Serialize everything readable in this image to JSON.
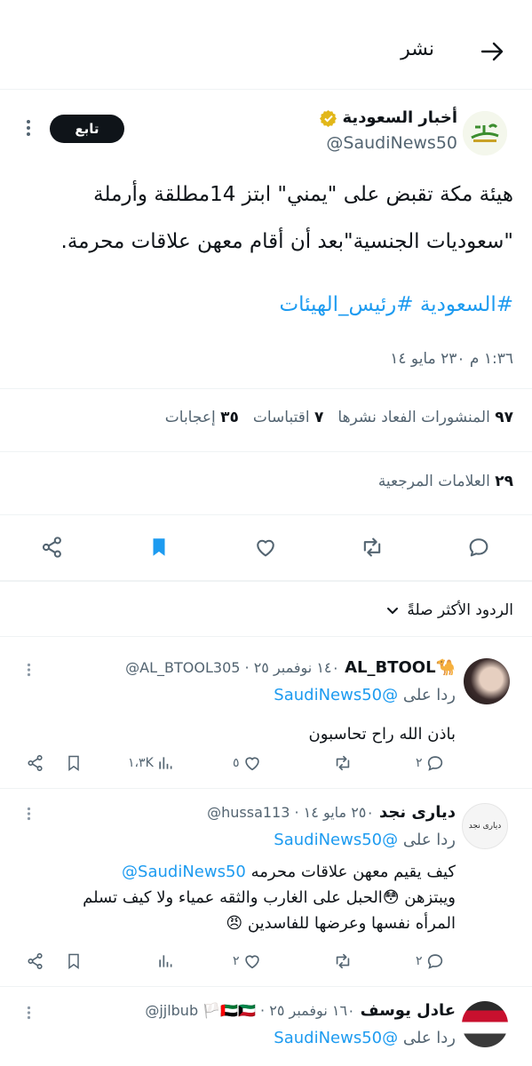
{
  "header": {
    "title": "نشر"
  },
  "post": {
    "name": "أخبار السعودية",
    "handle": "@SaudiNews50",
    "avatar_text": "أخبار",
    "follow_label": "تابع",
    "text_line1": "هيئة مكة تقبض على \"يمني\"  ابتز 14مطلقة وأرملة",
    "text_line2": "\"سعوديات الجنسية\"بعد أن أقام معهن علاقات محرمة.",
    "hashtags": "#السعودية #رئيس_الهيئات",
    "time": "١:٣٦ م ٢٣٠ مايو ١٤",
    "stats": [
      {
        "count": "٩٧",
        "label": "المنشورات الفعاد نشرها"
      },
      {
        "count": "٧",
        "label": "اقتباسات"
      },
      {
        "count": "٣٥",
        "label": "إعجابات"
      }
    ],
    "bookmarks": {
      "count": "٢٩",
      "label": "العلامات المرجعية"
    }
  },
  "sort": {
    "label": "الردود الأكثر صلةً"
  },
  "replies": [
    {
      "name": "AL_BTOOL🐪",
      "handle_meta": "@AL_BTOOL305 · ١٤٠ نوفمبر ٢٥",
      "reply_prefix": "ردا على",
      "reply_to": "@SaudiNews50",
      "body": "باذن الله راح تحاسبون",
      "views": "١،٣K",
      "likes": "٥",
      "replies_count": "٢",
      "retweets": ""
    },
    {
      "name": "ديارى نجد",
      "handle_meta": "@hussa113 · ٢٥٠ مايو ١٤",
      "reply_prefix": "ردا على",
      "reply_to": "@SaudiNews50",
      "body_mention": "@SaudiNews50",
      "body_line1": "كيف يقيم معهن علاقات محرمه",
      "body_line2": "ويبتزهن 😳الحبل على الغارب والثقه عمياء ولا كيف تسلم",
      "body_line3": "المرأه نفسها وعرضها للفاسدين 😠",
      "views": "",
      "likes": "٢",
      "replies_count": "٢",
      "retweets": "",
      "avatar_text": "ديارى نجد"
    },
    {
      "name": "عادل يوسف",
      "handle_meta": "@jjlbub 🏳️🇦🇪🇰🇼 · ١٦٠ نوفمبر ٢٥",
      "reply_prefix": "ردا على",
      "reply_to": "@SaudiNews50"
    }
  ]
}
